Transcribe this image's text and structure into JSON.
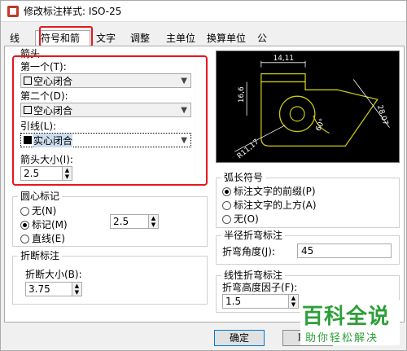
{
  "window": {
    "title": "修改标注样式: ISO-25"
  },
  "tabs": [
    "线",
    "符号和箭头",
    "文字",
    "调整",
    "主单位",
    "换算单位",
    "公差"
  ],
  "arrowheads": {
    "title": "箭头",
    "first_label": "第一个(T):",
    "first_value": "空心闭合",
    "second_label": "第二个(D):",
    "second_value": "空心闭合",
    "leader_label": "引线(L):",
    "leader_value": "实心闭合",
    "size_label": "箭头大小(I):",
    "size_value": "2.5"
  },
  "center_marks": {
    "title": "圆心标记",
    "none_label": "无(N)",
    "mark_label": "标记(M)",
    "line_label": "直线(E)",
    "size_value": "2.5"
  },
  "dim_break": {
    "title": "折断标注",
    "size_label": "折断大小(B):",
    "size_value": "3.75"
  },
  "arc_length": {
    "title": "弧长符号",
    "opt1": "标注文字的前缀(P)",
    "opt2": "标注文字的上方(A)",
    "opt3": "无(O)"
  },
  "radius_jog": {
    "title": "半径折弯标注",
    "angle_label": "折弯角度(J):",
    "angle_value": "45"
  },
  "linear_jog": {
    "title": "线性折弯标注",
    "factor_label": "折弯高度因子(F):",
    "factor_value": "1.5"
  },
  "preview": {
    "dim_top": "14,11",
    "dim_left": "16,6",
    "dim_right": "28,07",
    "dim_angle": "60°",
    "dim_radius": "R11,17"
  },
  "buttons": {
    "ok": "确定",
    "cancel": "取消"
  },
  "watermark": {
    "main": "百科全说",
    "sub": "助你轻松解决"
  },
  "colors": {
    "highlight": "#e8161e",
    "preview_bg": "#000000",
    "watermark": "#2e9e3a"
  }
}
